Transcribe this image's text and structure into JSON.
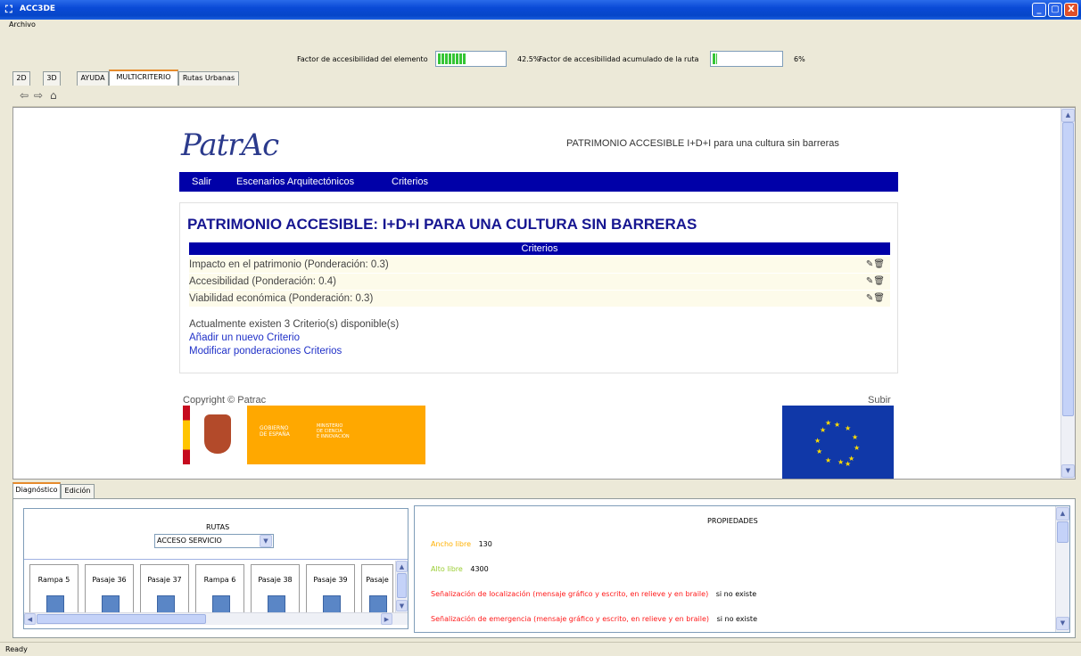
{
  "window": {
    "title": "ACC3DE",
    "min": "_",
    "max": "▢",
    "close": "X"
  },
  "menu": {
    "archivo": "Archivo"
  },
  "metrics": {
    "element_label": "Factor de accesibilidad del elemento",
    "element_percent_text": "42.5%",
    "element_value": 0.425,
    "route_label": "Factor de accesibilidad acumulado de la ruta",
    "route_percent_text": "6%",
    "route_value": 0.06
  },
  "tabs": [
    "2D",
    "3D",
    "AYUDA",
    "MULTICRITERIO",
    "Rutas Urbanas"
  ],
  "active_tab": "MULTICRITERIO",
  "toolbar_icons": [
    "back-arrow-icon",
    "forward-arrow-icon",
    "home-icon"
  ],
  "web": {
    "logo": "PatrAc",
    "header_text": "PATRIMONIO ACCESIBLE  I+D+I para una cultura sin barreras",
    "nav": [
      "Salir",
      "Escenarios Arquitectónicos",
      "Criterios"
    ],
    "heading": "PATRIMONIO ACCESIBLE: I+D+I PARA UNA CULTURA SIN BARRERAS",
    "criteria_header": "Criterios",
    "criteria": [
      "Impacto en el patrimonio (Ponderación: 0.3)",
      "Accesibilidad (Ponderación: 0.4)",
      "Viabilidad económica (Ponderación: 0.3)"
    ],
    "available_text": "Actualmente existen 3 Criterio(s) disponible(s)",
    "add_link": "Añadir un nuevo Criterio",
    "modify_link": "Modificar ponderaciones Criterios",
    "copyright": "Copyright © Patrac",
    "subir": "Subir",
    "gov_left": "GOBIERNO\nDE ESPAÑA",
    "gov_right": "MINISTERIO\nDE CIENCIA\nE INNOVACIÓN"
  },
  "bottom_tabs": [
    "Diagnóstico",
    "Edición"
  ],
  "rutas": {
    "title": "RUTAS",
    "selected": "ACCESO SERVICIO",
    "cards": [
      "Rampa 5",
      "Pasaje 36",
      "Pasaje 37",
      "Rampa 6",
      "Pasaje 38",
      "Pasaje 39",
      "Pasaje"
    ]
  },
  "propiedades": {
    "title": "PROPIEDADES",
    "items": [
      {
        "label": "Ancho libre",
        "value": "130",
        "color": "#ffb000"
      },
      {
        "label": "Alto libre",
        "value": "4300",
        "color": "#9acd32"
      },
      {
        "label": "Señalización de localización (mensaje gráfico y escrito, en relieve y en braile)",
        "value": "si no existe",
        "color": "#ff1a1a"
      },
      {
        "label": "Señalización de emergencia (mensaje gráfico y escrito, en relieve y en braile)",
        "value": "si no existe",
        "color": "#ff1a1a"
      }
    ]
  },
  "status": "Ready"
}
